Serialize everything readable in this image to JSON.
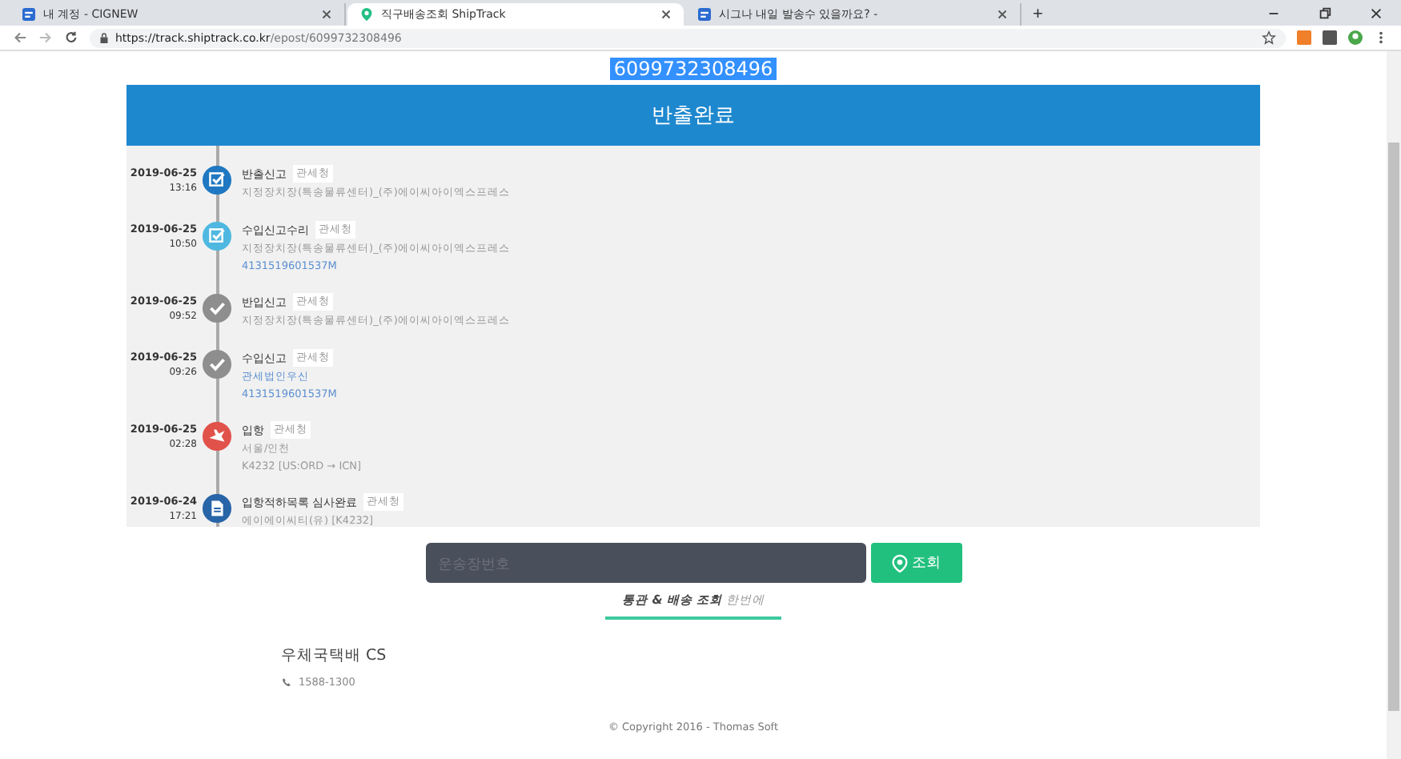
{
  "browser": {
    "tabs": [
      {
        "title": "내 계정 - CIGNEW",
        "selected": false,
        "kind": "doc"
      },
      {
        "title": "직구배송조회 ShipTrack",
        "selected": true,
        "kind": "pin"
      },
      {
        "title": "시그나 내일 발송수 있을까요? -",
        "selected": false,
        "kind": "doc"
      }
    ],
    "new_tab": "+",
    "url_host": "https://track.shiptrack.co.kr",
    "url_path": "/epost/6099732308496"
  },
  "tracking_number": "6099732308496",
  "status": "반출완료",
  "events": [
    {
      "date": "2019-06-25",
      "time": "13:16",
      "title": "반출신고",
      "tag": "관세청",
      "kind": "check",
      "color": "#1f78c1",
      "lines": [
        {
          "text": "지정장치장(특송물류센터)_(주)에이씨아이엑스프레스",
          "link": false
        }
      ]
    },
    {
      "date": "2019-06-25",
      "time": "10:50",
      "title": "수입신고수리",
      "tag": "관세청",
      "kind": "check",
      "color": "#4fb8e0",
      "lines": [
        {
          "text": "지정장치장(특송물류센터)_(주)에이씨아이엑스프레스",
          "link": false
        },
        {
          "text": "4131519601537M",
          "link": true
        }
      ]
    },
    {
      "date": "2019-06-25",
      "time": "09:52",
      "title": "반입신고",
      "tag": "관세청",
      "kind": "tick",
      "color": "#8e8e8e",
      "lines": [
        {
          "text": "지정장치장(특송물류센터)_(주)에이씨아이엑스프레스",
          "link": false
        }
      ]
    },
    {
      "date": "2019-06-25",
      "time": "09:26",
      "title": "수입신고",
      "tag": "관세청",
      "kind": "tick",
      "color": "#8e8e8e",
      "lines": [
        {
          "text": "관세법인우신",
          "link": true
        },
        {
          "text": "4131519601537M",
          "link": true
        }
      ]
    },
    {
      "date": "2019-06-25",
      "time": "02:28",
      "title": "입항",
      "tag": "관세청",
      "kind": "plane",
      "color": "#e0524a",
      "lines": [
        {
          "text": "서울/인천",
          "link": false
        },
        {
          "text": "K4232 [US:ORD → ICN]",
          "link": false
        }
      ]
    },
    {
      "date": "2019-06-24",
      "time": "17:21",
      "title": "입항적하목록 심사완료",
      "tag": "관세청",
      "kind": "doc",
      "color": "#2864a8",
      "lines": [
        {
          "text": "에이에이씨티(유) [K4232]",
          "link": false
        }
      ]
    }
  ],
  "search": {
    "placeholder": "운송장번호",
    "button": "조회"
  },
  "subnav": {
    "bold": "통관 & 배송 조회",
    "rest": "한번에"
  },
  "cs": {
    "title": "우체국택배 CS",
    "phone": "1588-1300"
  },
  "copyright": "© Copyright 2016 - Thomas Soft"
}
